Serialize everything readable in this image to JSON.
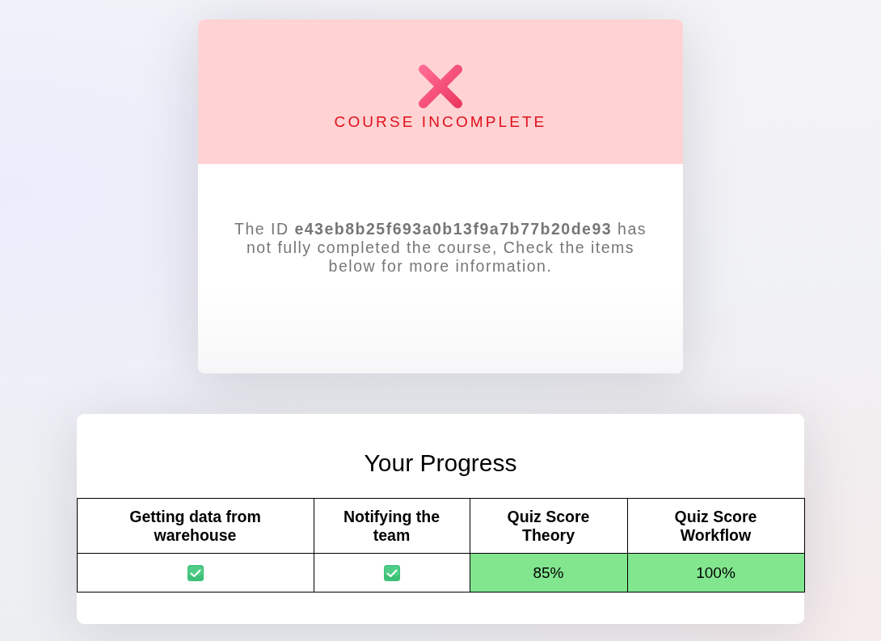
{
  "status_card": {
    "complete": false,
    "title": "COURSE INCOMPLETE",
    "message": "The ID **e43eb8b25f693a0b13f9a7b77b20de93** has not fully completed the course, Check the items below for more information."
  },
  "progress": {
    "title": "Your Progress",
    "table": {
      "columns": [
        "Getting data from warehouse",
        "Notifying the team",
        "Quiz Score Theory",
        "Quiz Score Workflow"
      ],
      "rows": [
        {
          "cells": [
            {
              "kind": "check",
              "checked": true
            },
            {
              "kind": "check",
              "checked": true
            },
            {
              "kind": "score",
              "text": "85%",
              "passed": true
            },
            {
              "kind": "score",
              "text": "100%",
              "passed": true
            }
          ]
        }
      ]
    }
  }
}
